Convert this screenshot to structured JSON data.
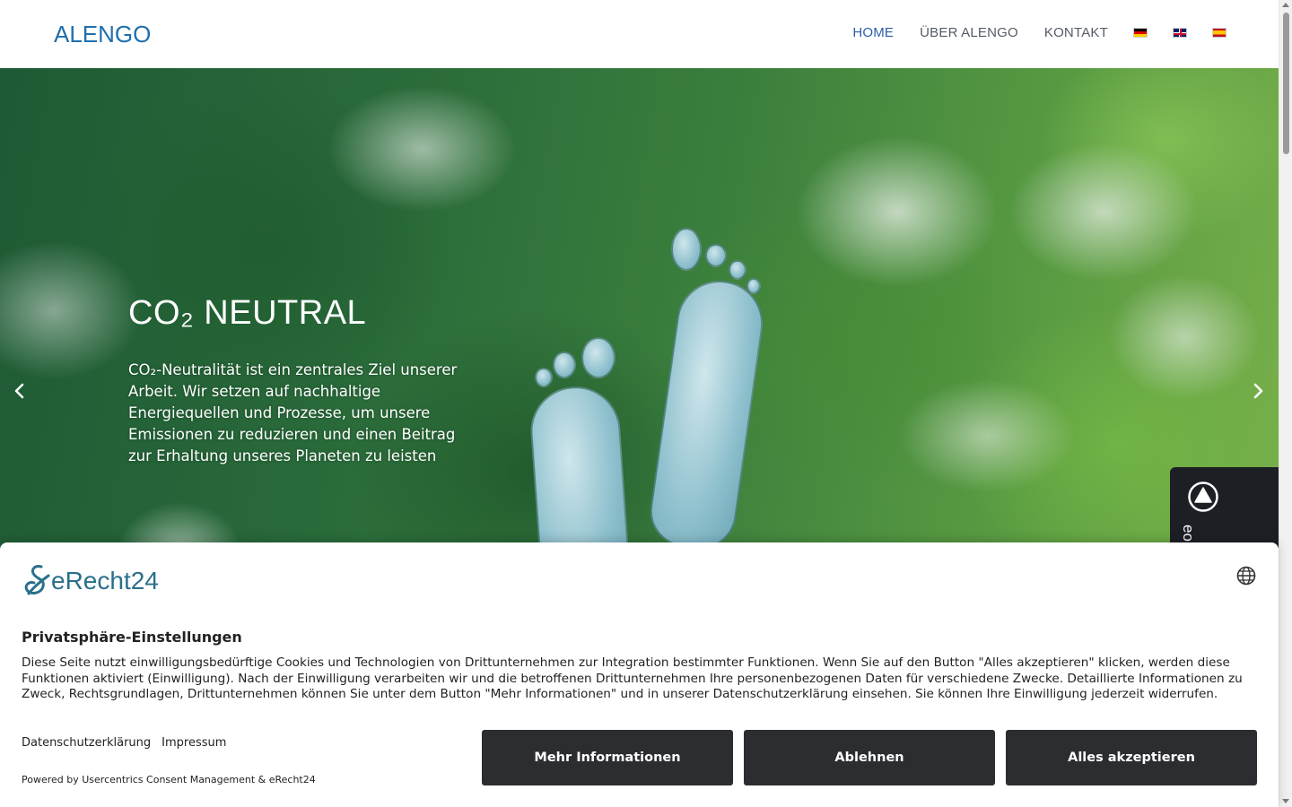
{
  "header": {
    "logo_text": "ALENGO",
    "nav": [
      {
        "label": "HOME",
        "active": true
      },
      {
        "label": "ÜBER ALENGO",
        "active": false
      },
      {
        "label": "KONTAKT",
        "active": false
      }
    ],
    "flags": [
      "de-flag-icon",
      "gb-flag-icon",
      "es-flag-icon"
    ],
    "brand_color": "#1f6fae",
    "active_color": "#2f5da8"
  },
  "hero": {
    "title": "CO₂ NEUTRAL",
    "text": "CO₂-Neutralität ist ein zentrales Ziel unserer Arbeit. Wir setzen auf nachhaltige Energiequellen und Prozesse, um unsere Emissionen zu reduzieren und einen Beitrag zur Erhaltung unseres Planeten zu leisten",
    "prev_icon": "chevron-left-icon",
    "next_icon": "chevron-right-icon"
  },
  "side_widget": {
    "label": "eo",
    "icon": "triangle-circle-icon"
  },
  "consent": {
    "brand_name": "eRecht24",
    "title": "Privatsphäre-Einstellungen",
    "text": "Diese Seite nutzt einwilligungsbedürftige Cookies und Technologien von Drittunternehmen zur Integration bestimmter Funktionen. Wenn Sie auf den Button \"Alles akzeptieren\" klicken, werden diese Funktionen aktiviert (Einwilligung). Nach der Einwilligung verarbeiten wir und die betroffenen Drittunternehmen Ihre personenbezogenen Daten für verschiedene Zwecke. Detaillierte Informationen zu Zweck, Rechtsgrundlagen, Drittunternehmen können Sie unter dem Button \"Mehr Informationen\" und in unserer Datenschutzerklärung einsehen. Sie können Ihre Einwilligung jederzeit widerrufen.",
    "link_privacy": "Datenschutzerklärung",
    "link_imprint": "Impressum",
    "powered_by": "Powered by Usercentrics Consent Management & eRecht24",
    "btn_more": "Mehr Informationen",
    "btn_deny": "Ablehnen",
    "btn_accept": "Alles akzeptieren",
    "button_color": "#2b2d31"
  }
}
